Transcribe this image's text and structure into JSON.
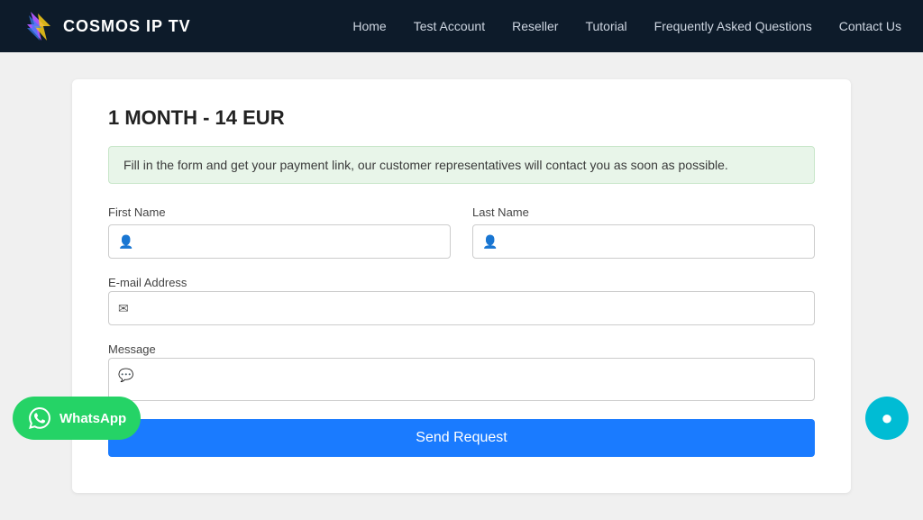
{
  "navbar": {
    "logo_text": "COSMOS IP TV",
    "links": [
      {
        "label": "Home",
        "href": "#"
      },
      {
        "label": "Test Account",
        "href": "#"
      },
      {
        "label": "Reseller",
        "href": "#"
      },
      {
        "label": "Tutorial",
        "href": "#"
      },
      {
        "label": "Frequently Asked Questions",
        "href": "#"
      },
      {
        "label": "Contact Us",
        "href": "#"
      }
    ]
  },
  "card": {
    "title": "1 MONTH - 14 EUR",
    "info_message": "Fill in the form and get your payment link, our customer representatives will contact you as soon as possible.",
    "first_name_label": "First Name",
    "last_name_label": "Last Name",
    "email_label": "E-mail Address",
    "message_label": "Message",
    "send_btn_label": "Send Request"
  },
  "whatsapp": {
    "label": "WhatsApp"
  },
  "icons": {
    "user": "👤",
    "email": "✉",
    "message": "💬"
  }
}
